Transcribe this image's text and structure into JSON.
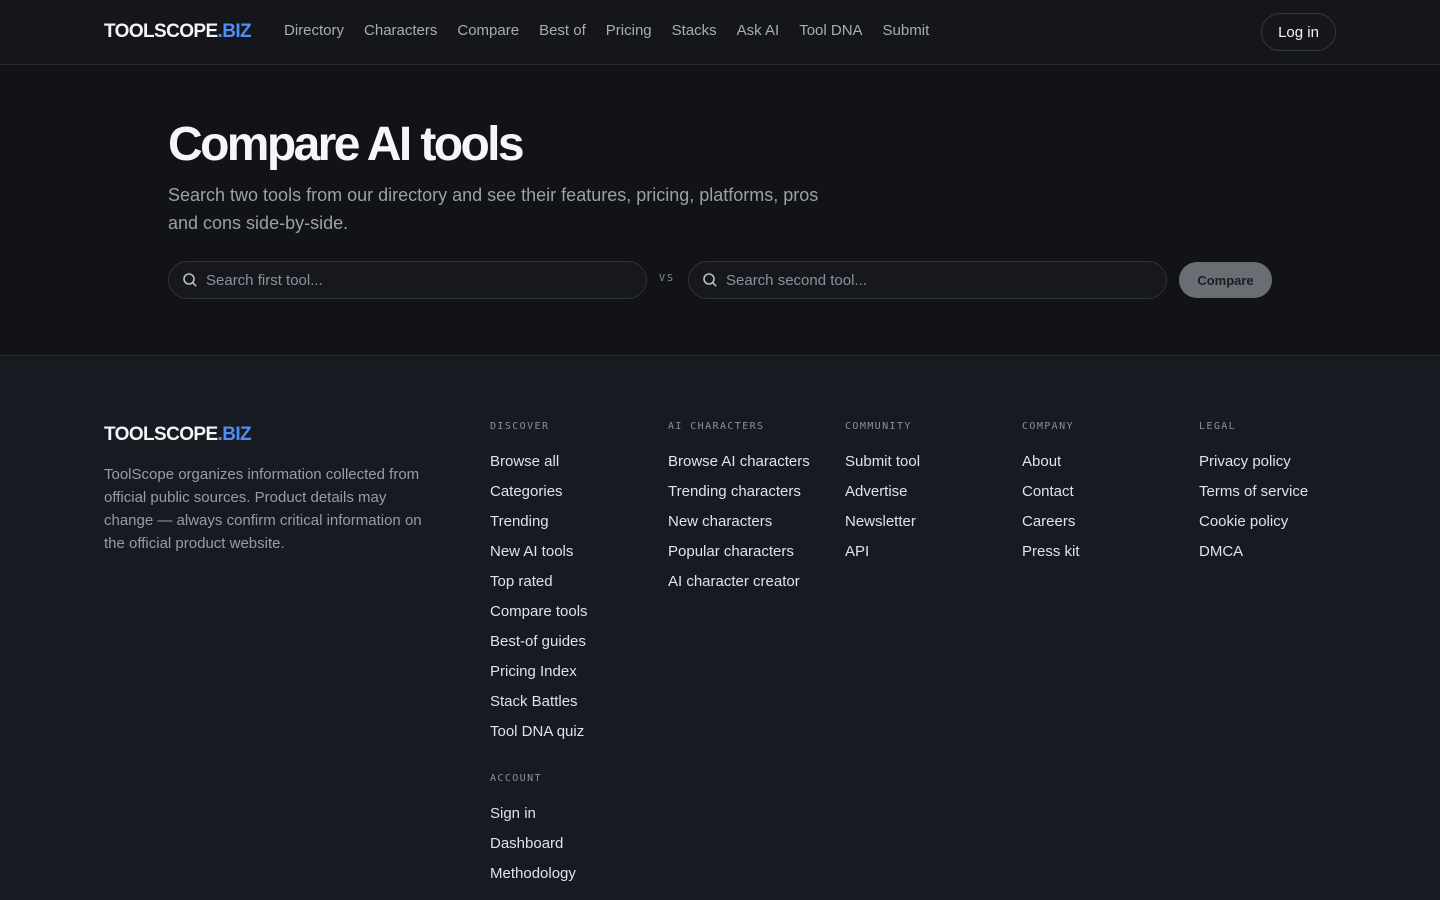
{
  "brand": {
    "name": "TOOLSCOPE",
    "tld": ".BIZ"
  },
  "nav": [
    "Directory",
    "Characters",
    "Compare",
    "Best of",
    "Pricing",
    "Stacks",
    "Ask AI",
    "Tool DNA",
    "Submit"
  ],
  "header": {
    "login_label": "Log in"
  },
  "hero": {
    "title": "Compare AI tools",
    "subtitle": "Search two tools from our directory and see their features, pricing, platforms, pros and cons side-by-side.",
    "first_placeholder": "Search first tool...",
    "second_placeholder": "Search second tool...",
    "vs_label": "VS",
    "compare_label": "Compare"
  },
  "footer": {
    "description": "ToolScope organizes information collected from official public sources. Product details may change — always confirm critical information on the official product website.",
    "discover": {
      "heading": "DISCOVER",
      "links": [
        "Browse all",
        "Categories",
        "Trending",
        "New AI tools",
        "Top rated",
        "Compare tools",
        "Best-of guides",
        "Pricing Index",
        "Stack Battles",
        "Tool DNA quiz"
      ]
    },
    "account": {
      "heading": "ACCOUNT",
      "links": [
        "Sign in",
        "Dashboard",
        "Methodology"
      ]
    },
    "ai_characters": {
      "heading": "AI CHARACTERS",
      "links": [
        "Browse AI characters",
        "Trending characters",
        "New characters",
        "Popular characters",
        "AI character creator"
      ]
    },
    "community": {
      "heading": "COMMUNITY",
      "links": [
        "Submit tool",
        "Advertise",
        "Newsletter",
        "API"
      ]
    },
    "company": {
      "heading": "COMPANY",
      "links": [
        "About",
        "Contact",
        "Careers",
        "Press kit"
      ]
    },
    "legal": {
      "heading": "LEGAL",
      "links": [
        "Privacy policy",
        "Terms of service",
        "Cookie policy",
        "DMCA"
      ]
    }
  },
  "icons": {
    "search": "search-icon"
  },
  "colors": {
    "accent": "#4f8ef7",
    "background": "#111317"
  }
}
